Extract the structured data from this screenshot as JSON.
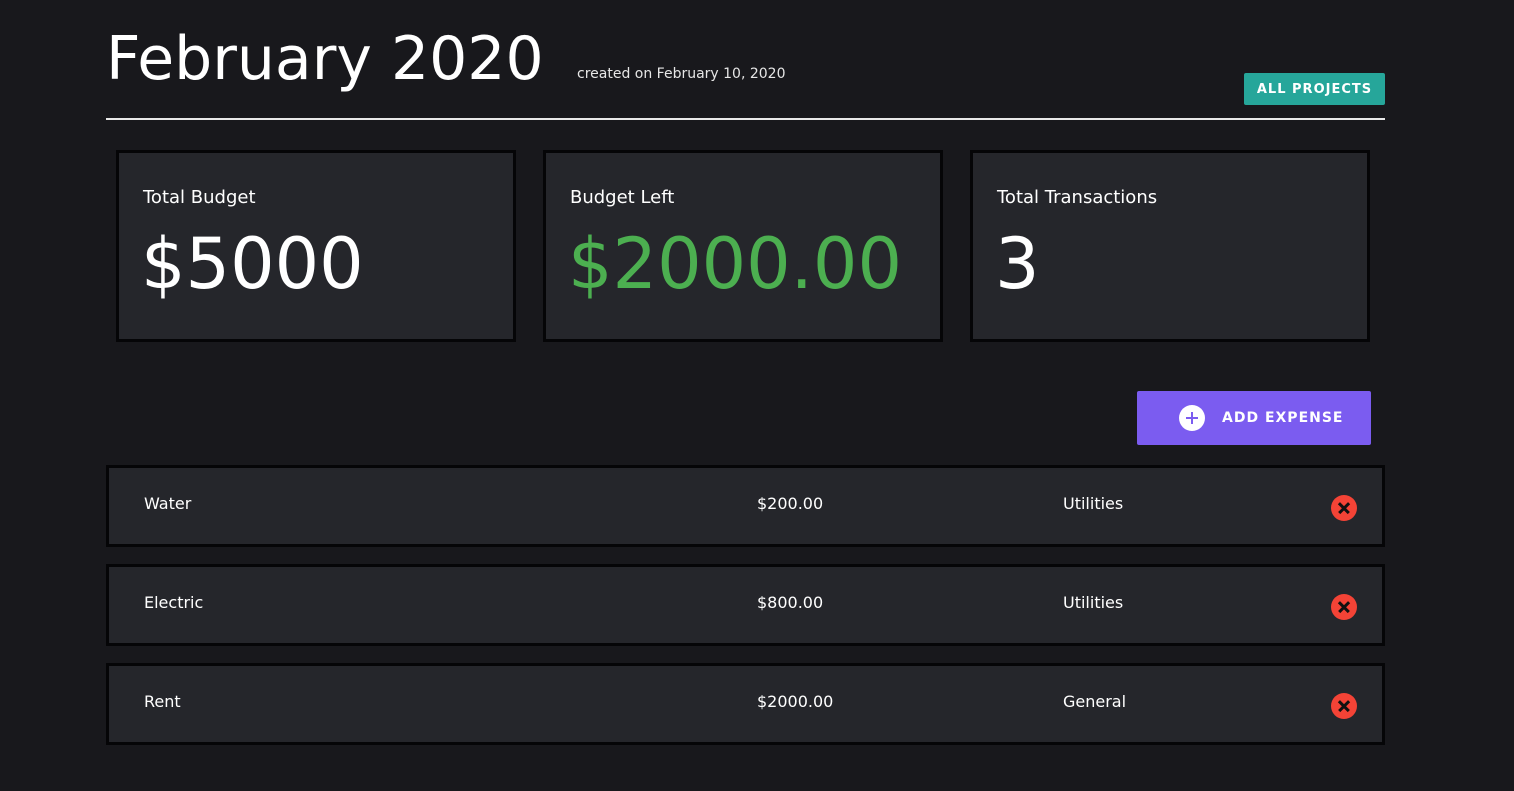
{
  "header": {
    "title": "February 2020",
    "created": "created on February 10, 2020",
    "all_projects_label": "ALL PROJECTS"
  },
  "summary": [
    {
      "label": "Total Budget",
      "value": "$5000"
    },
    {
      "label": "Budget Left",
      "value": "$2000.00"
    },
    {
      "label": "Total Transactions",
      "value": "3"
    }
  ],
  "add_expense": {
    "label": "ADD EXPENSE",
    "icon": "plus-circle-icon"
  },
  "expenses": [
    {
      "name": "Water",
      "amount": "$200.00",
      "category": "Utilities"
    },
    {
      "name": "Electric",
      "amount": "$800.00",
      "category": "Utilities"
    },
    {
      "name": "Rent",
      "amount": "$2000.00",
      "category": "General"
    }
  ],
  "colors": {
    "background": "#18181c",
    "card": "#25262b",
    "accent_teal": "#26a69a",
    "accent_purple": "#7b5cf0",
    "budget_left": "#4caf50",
    "delete": "#f44336"
  }
}
